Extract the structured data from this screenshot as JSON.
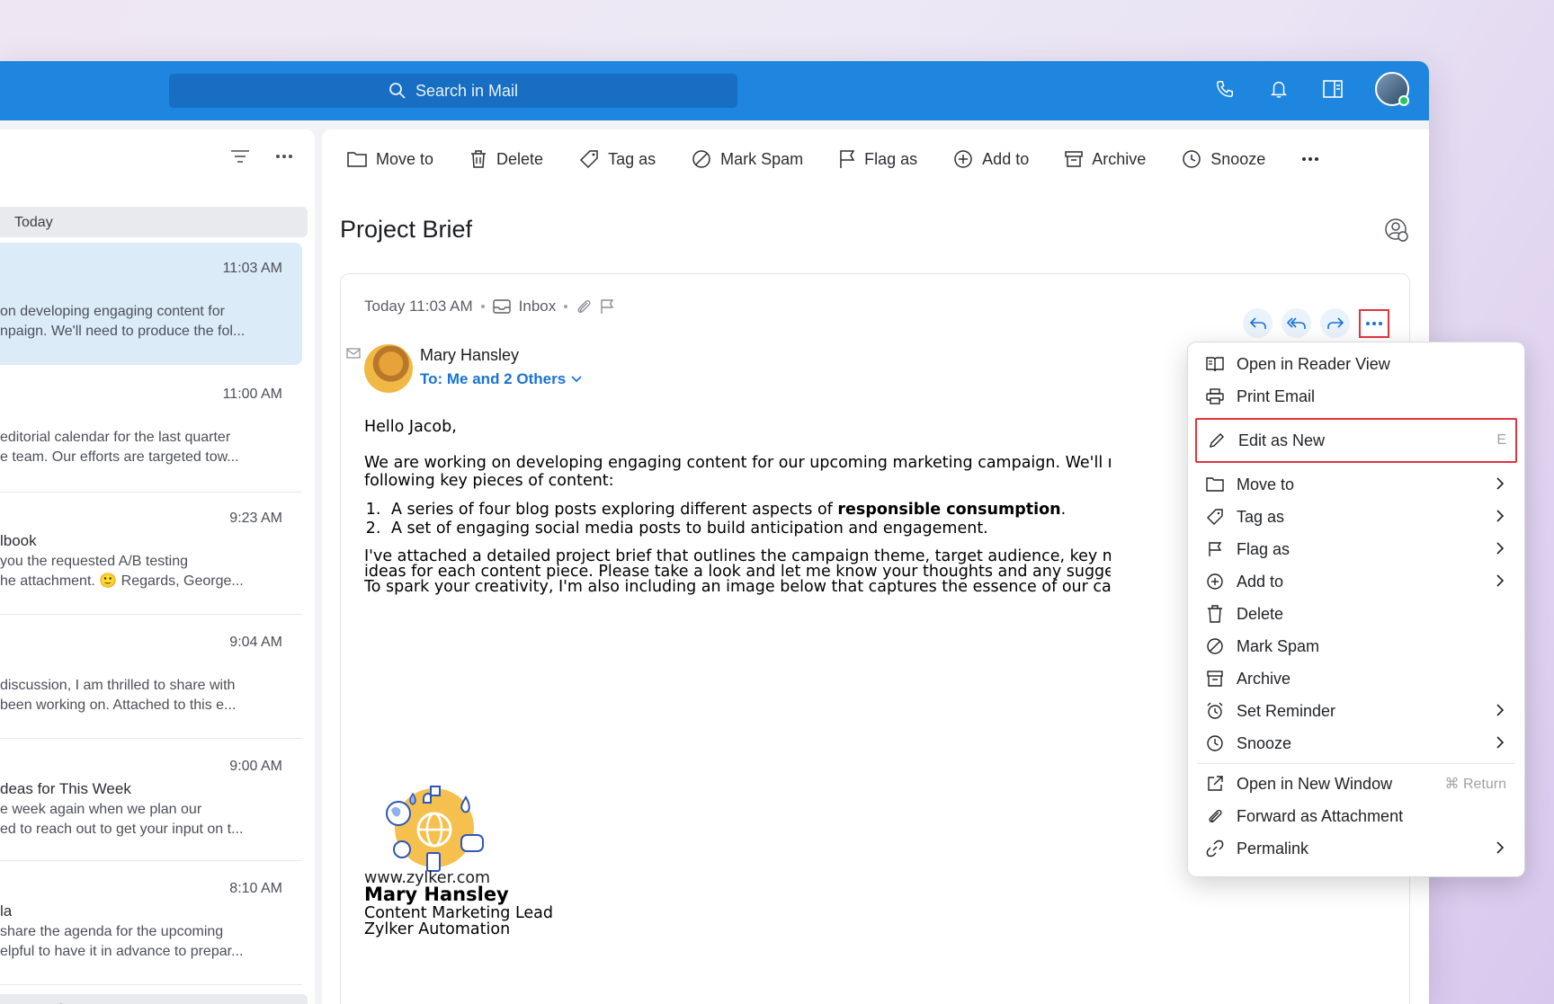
{
  "search": {
    "placeholder": "Search in Mail"
  },
  "list": {
    "groups": [
      "Today",
      "Yesterday"
    ],
    "items": [
      {
        "time": "11:03 AM",
        "subject": "",
        "preview1": "on developing engaging content for",
        "preview2": "npaign. We'll need to produce the fol..."
      },
      {
        "time": "11:00 AM",
        "subject": "",
        "preview1": "editorial calendar for the last quarter",
        "preview2": "e team. Our efforts are targeted tow..."
      },
      {
        "time": "9:23 AM",
        "subject": "lbook",
        "preview1": "you the requested A/B testing",
        "preview2": "he attachment. 🙂 Regards, George..."
      },
      {
        "time": "9:04 AM",
        "subject": "",
        "preview1": "discussion, I am thrilled to share with",
        "preview2": "been working on. Attached to this e..."
      },
      {
        "time": "9:00 AM",
        "subject": "deas for This Week",
        "preview1": "e week again when we plan our",
        "preview2": "ed to reach out to get your input on t..."
      },
      {
        "time": "8:10 AM",
        "subject": "la",
        "preview1": "share the agenda for the upcoming",
        "preview2": "elpful to have it in advance to prepar..."
      }
    ]
  },
  "toolbar": {
    "move_to": "Move to",
    "delete": "Delete",
    "tag_as": "Tag as",
    "mark_spam": "Mark Spam",
    "flag_as": "Flag as",
    "add_to": "Add to",
    "archive": "Archive",
    "snooze": "Snooze"
  },
  "message": {
    "subject": "Project Brief",
    "date": "Today 11:03 AM",
    "folder": "Inbox",
    "sender": "Mary Hansley",
    "to": "To: Me and 2 Others",
    "greeting": "Hello Jacob,",
    "para1a": "We are working on developing engaging content for our upcoming marketing campaign. We'll need",
    "para1b": "following key pieces of content:",
    "li1a": "A series of four blog posts exploring different aspects of ",
    "li1b": "responsible consumption",
    "li1c": ".",
    "li2": "A set of engaging social media posts to build anticipation and engagement.",
    "para2a": "I've attached a detailed project brief that outlines the campaign theme, target audience, key mess",
    "para2b": "ideas for each content piece. Please take a look and let me know your thoughts and any suggestio",
    "para2c": "To spark your creativity, I'm also including an image below that captures the essence of our campa",
    "sig_name": "Mary Hansley",
    "sig_role": "Content Marketing Lead",
    "sig_company": "Zylker Automation",
    "website": "www.zylker.com"
  },
  "menu": {
    "reader_view": "Open in Reader View",
    "print": "Print Email",
    "edit_new": "Edit as New",
    "edit_new_shortcut": "E",
    "move_to": "Move to",
    "tag_as": "Tag as",
    "flag_as": "Flag as",
    "add_to": "Add to",
    "delete": "Delete",
    "mark_spam": "Mark Spam",
    "archive": "Archive",
    "set_reminder": "Set Reminder",
    "snooze": "Snooze",
    "new_window": "Open in New Window",
    "new_window_shortcut": "⌘ Return",
    "forward_attachment": "Forward as Attachment",
    "permalink": "Permalink"
  },
  "colors": {
    "topbar": "#1f86e0",
    "accent_link": "#1a73d4",
    "highlight_border": "#e0353f",
    "selected_row": "#dcebf8"
  }
}
